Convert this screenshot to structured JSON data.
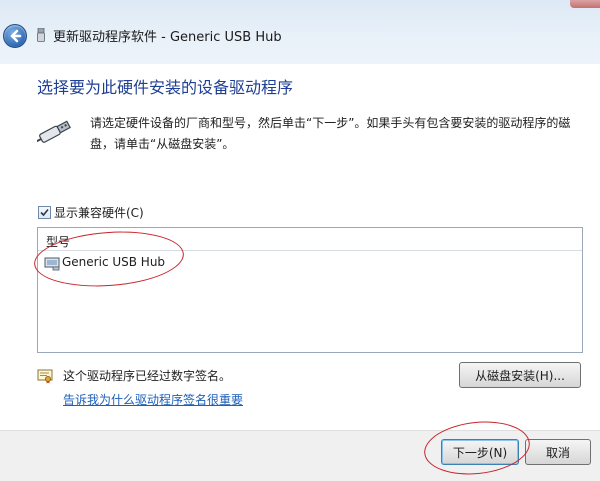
{
  "window": {
    "title": "更新驱动程序软件 - Generic USB Hub"
  },
  "heading": "选择要为此硬件安装的设备驱动程序",
  "instruction": "请选定硬件设备的厂商和型号，然后单击“下一步”。如果手头有包含要安装的驱动程序的磁盘，请单击“从磁盘安装”。",
  "compat": {
    "label": "显示兼容硬件(C)",
    "checked": true
  },
  "model_list": {
    "header": "型号",
    "items": [
      "Generic USB Hub"
    ]
  },
  "signature": {
    "status": "这个驱动程序已经过数字签名。",
    "link": "告诉我为什么驱动程序签名很重要"
  },
  "buttons": {
    "have_disk": "从磁盘安装(H)...",
    "next": "下一步(N)",
    "cancel": "取消"
  },
  "colors": {
    "heading": "#1f3f94",
    "link": "#1c5fb8",
    "annotation": "#c8242c"
  },
  "icons": {
    "back": "back-arrow-icon",
    "usb_small": "usb-device-icon",
    "usb_large": "usb-plug-icon",
    "row": "hardware-device-icon",
    "signed": "signed-certificate-icon"
  }
}
